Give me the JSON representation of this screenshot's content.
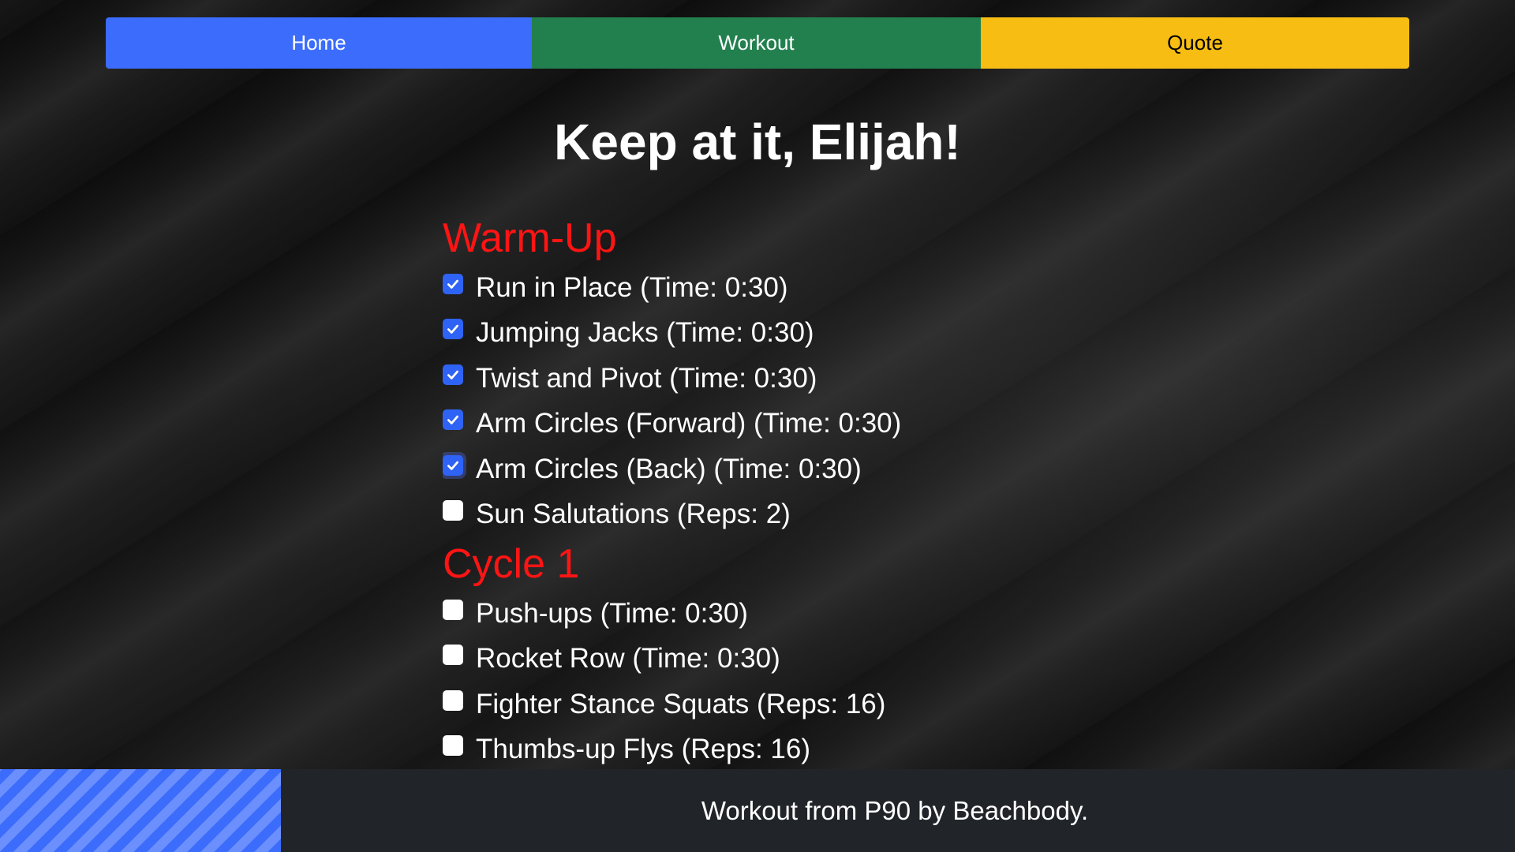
{
  "nav": {
    "home_label": "Home",
    "workout_label": "Workout",
    "quote_label": "Quote"
  },
  "page_title": "Keep at it, Elijah!",
  "sections": [
    {
      "title": "Warm-Up",
      "exercises": [
        {
          "label": "Run in Place (Time: 0:30)",
          "checked": true
        },
        {
          "label": "Jumping Jacks (Time: 0:30)",
          "checked": true
        },
        {
          "label": "Twist and Pivot (Time: 0:30)",
          "checked": true
        },
        {
          "label": "Arm Circles (Forward) (Time: 0:30)",
          "checked": true
        },
        {
          "label": "Arm Circles (Back) (Time: 0:30)",
          "checked": true
        },
        {
          "label": "Sun Salutations (Reps: 2)",
          "checked": false
        }
      ]
    },
    {
      "title": "Cycle 1",
      "exercises": [
        {
          "label": "Push-ups (Time: 0:30)",
          "checked": false
        },
        {
          "label": "Rocket Row (Time: 0:30)",
          "checked": false
        },
        {
          "label": "Fighter Stance Squats (Reps: 16)",
          "checked": false
        },
        {
          "label": "Thumbs-up Flys (Reps: 16)",
          "checked": false
        }
      ]
    }
  ],
  "footer": {
    "text": "Workout from P90 by Beachbody."
  },
  "colors": {
    "home": "#3c6cfb",
    "workout": "#22804f",
    "quote": "#f7bd13",
    "section_title": "#ff1414",
    "checkbox_checked": "#2f63f5",
    "footer_bg": "#212529"
  },
  "icons": {
    "checked": "checkmark-icon"
  }
}
